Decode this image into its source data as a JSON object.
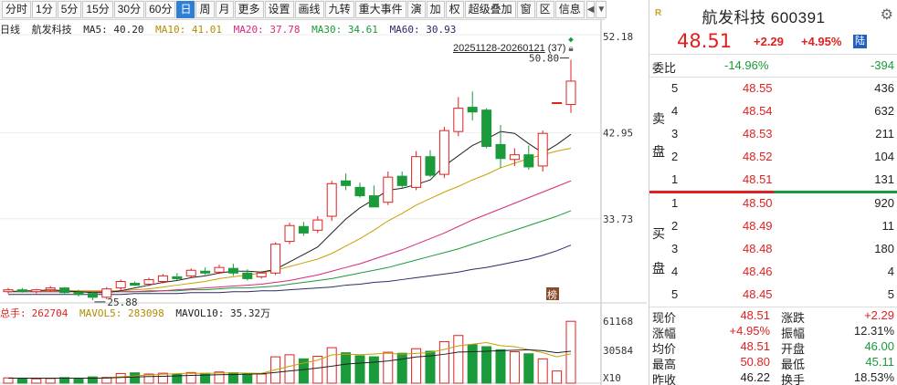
{
  "toolbar": {
    "buttons": [
      "分时",
      "1分",
      "5分",
      "15分",
      "30分",
      "60分",
      "日",
      "周",
      "月",
      "更多",
      "设置",
      "画线",
      "九转",
      "重大事件",
      "演",
      "加",
      "权",
      "超级叠加",
      "窗",
      "区",
      "信息"
    ],
    "active_index": 6
  },
  "ma_line": {
    "period": "日线",
    "name": "航发科技",
    "ma5": "MA5: 40.20",
    "ma10": "MA10: 41.01",
    "ma20": "MA20: 37.78",
    "ma30": "MA30: 34.61",
    "ma60": "MA60: 30.93",
    "colors": {
      "ma5": "#222222",
      "ma10": "#c8a000",
      "ma20": "#d6287c",
      "ma30": "#1a9a3a",
      "ma60": "#2a2a66"
    }
  },
  "range_label": {
    "text": "20251128-20260121",
    "count": "(37)"
  },
  "price_axis": {
    "top": "52.18",
    "mid": "42.95",
    "low": "33.73"
  },
  "annotations": {
    "high": "50.80",
    "low": "25.88",
    "badge": "榜"
  },
  "volume": {
    "label": "总手:",
    "total": "262704",
    "mavol5": "MAVOL5: 283098",
    "mavol10": "MAVOL10: 35.32万",
    "axis_top": "61168",
    "axis_mid": "30584",
    "axis_unit": "X10"
  },
  "chart_data": {
    "type": "candlestick",
    "price_range": [
      24.5,
      53.5
    ],
    "candles": [
      [
        25.9,
        26.3,
        25.7,
        26.1
      ],
      [
        26.1,
        26.3,
        25.8,
        25.9
      ],
      [
        25.9,
        26.2,
        25.7,
        26.1
      ],
      [
        26.1,
        26.5,
        25.9,
        26.3
      ],
      [
        26.3,
        26.4,
        25.7,
        25.8
      ],
      [
        25.8,
        26.1,
        25.4,
        25.6
      ],
      [
        25.7,
        25.9,
        25.0,
        25.3
      ],
      [
        25.3,
        26.4,
        25.1,
        26.2
      ],
      [
        26.3,
        27.2,
        26.0,
        27.0
      ],
      [
        26.8,
        27.0,
        26.5,
        26.6
      ],
      [
        26.7,
        27.4,
        26.5,
        27.2
      ],
      [
        27.0,
        27.8,
        26.8,
        27.6
      ],
      [
        27.5,
        27.9,
        27.1,
        27.3
      ],
      [
        27.6,
        28.4,
        27.4,
        28.2
      ],
      [
        28.1,
        28.5,
        27.7,
        27.9
      ],
      [
        28.0,
        28.8,
        27.8,
        28.5
      ],
      [
        28.4,
        28.9,
        27.6,
        27.9
      ],
      [
        27.9,
        28.3,
        27.1,
        27.3
      ],
      [
        27.5,
        28.1,
        27.3,
        27.9
      ],
      [
        27.9,
        31.2,
        27.7,
        31.0
      ],
      [
        31.3,
        33.3,
        31.0,
        33.0
      ],
      [
        32.9,
        33.4,
        31.9,
        32.2
      ],
      [
        32.5,
        34.0,
        32.2,
        33.6
      ],
      [
        34.0,
        37.8,
        33.5,
        37.5
      ],
      [
        37.8,
        38.6,
        36.8,
        37.3
      ],
      [
        37.1,
        37.6,
        36.0,
        36.2
      ],
      [
        36.2,
        37.3,
        35.0,
        35.0
      ],
      [
        35.5,
        38.8,
        35.2,
        38.2
      ],
      [
        38.3,
        38.8,
        37.0,
        37.3
      ],
      [
        37.1,
        41.0,
        36.8,
        40.4
      ],
      [
        40.4,
        41.1,
        38.2,
        38.4
      ],
      [
        38.5,
        43.6,
        38.1,
        43.2
      ],
      [
        43.1,
        46.8,
        42.6,
        45.6
      ],
      [
        45.7,
        47.4,
        44.3,
        45.2
      ],
      [
        45.4,
        45.6,
        41.3,
        41.5
      ],
      [
        41.7,
        43.8,
        39.2,
        40.2
      ],
      [
        40.1,
        41.3,
        39.4,
        40.6
      ],
      [
        40.6,
        41.6,
        39.0,
        39.3
      ],
      [
        39.4,
        43.2,
        38.8,
        42.9
      ],
      [
        46.2,
        46.2,
        46.2,
        46.2
      ],
      [
        46.0,
        50.8,
        45.1,
        48.51
      ]
    ],
    "volumes": [
      5200,
      4800,
      4300,
      4600,
      5500,
      4900,
      6200,
      5800,
      9500,
      10200,
      9000,
      9800,
      8900,
      10500,
      9700,
      11000,
      10300,
      9600,
      9000,
      26000,
      28000,
      24000,
      26500,
      35000,
      30000,
      27000,
      26000,
      30500,
      29500,
      34000,
      31500,
      41000,
      47000,
      38000,
      36000,
      33000,
      31000,
      29000,
      24000,
      12000,
      61000
    ],
    "ma5": [
      25.9,
      26.0,
      26.0,
      26.1,
      26.0,
      25.9,
      25.8,
      25.8,
      26.0,
      26.3,
      26.6,
      26.9,
      27.1,
      27.4,
      27.6,
      27.9,
      28.1,
      28.1,
      28.0,
      28.3,
      29.1,
      29.9,
      30.7,
      32.2,
      33.7,
      34.9,
      35.8,
      36.8,
      37.0,
      37.4,
      37.9,
      39.4,
      40.5,
      41.6,
      42.3,
      43.1,
      42.9,
      41.8,
      40.8,
      41.7,
      42.8
    ],
    "ma10": [
      25.9,
      25.9,
      26.0,
      26.0,
      26.0,
      26.0,
      26.0,
      26.0,
      26.0,
      26.1,
      26.2,
      26.4,
      26.6,
      26.8,
      27.0,
      27.3,
      27.5,
      27.7,
      27.9,
      28.2,
      28.6,
      29.0,
      29.4,
      30.0,
      30.8,
      31.6,
      32.5,
      33.5,
      34.3,
      35.2,
      35.9,
      36.6,
      37.2,
      37.9,
      38.5,
      39.2,
      39.7,
      40.2,
      40.6,
      41.0,
      41.3
    ],
    "ma20": [
      25.9,
      25.9,
      25.9,
      25.9,
      25.9,
      25.9,
      25.9,
      25.9,
      25.9,
      25.9,
      26.0,
      26.0,
      26.1,
      26.2,
      26.3,
      26.4,
      26.5,
      26.6,
      26.7,
      26.9,
      27.1,
      27.4,
      27.7,
      28.1,
      28.5,
      28.9,
      29.4,
      29.9,
      30.4,
      31.0,
      31.6,
      32.2,
      32.9,
      33.6,
      34.2,
      34.8,
      35.4,
      36.0,
      36.6,
      37.2,
      37.8
    ],
    "ma30": [
      25.9,
      25.9,
      25.9,
      25.9,
      25.9,
      25.9,
      25.9,
      25.9,
      25.9,
      25.9,
      25.9,
      26.0,
      26.0,
      26.1,
      26.1,
      26.2,
      26.3,
      26.3,
      26.4,
      26.5,
      26.7,
      26.9,
      27.1,
      27.3,
      27.6,
      27.9,
      28.2,
      28.5,
      28.9,
      29.3,
      29.7,
      30.1,
      30.5,
      31.0,
      31.5,
      32.0,
      32.5,
      33.0,
      33.5,
      34.0,
      34.6
    ],
    "ma60": [
      25.6,
      25.6,
      25.6,
      25.6,
      25.6,
      25.6,
      25.6,
      25.6,
      25.6,
      25.7,
      25.7,
      25.7,
      25.7,
      25.8,
      25.8,
      25.8,
      25.9,
      25.9,
      26.0,
      26.0,
      26.1,
      26.2,
      26.3,
      26.4,
      26.6,
      26.7,
      26.9,
      27.0,
      27.2,
      27.4,
      27.6,
      27.8,
      28.0,
      28.3,
      28.5,
      28.8,
      29.1,
      29.4,
      29.8,
      30.3,
      30.9
    ],
    "vol_ma5": [
      5000,
      5000,
      4900,
      4900,
      4900,
      4800,
      5100,
      5300,
      6400,
      7200,
      8100,
      8800,
      9500,
      9800,
      9600,
      10000,
      10100,
      9900,
      9700,
      13300,
      16600,
      19800,
      22700,
      27900,
      28700,
      28100,
      28800,
      29600,
      28600,
      29400,
      30300,
      33300,
      36800,
      38500,
      40000,
      37000,
      36000,
      33000,
      30000,
      26000,
      29000
    ],
    "vol_ma10": [
      5000,
      5000,
      5000,
      5000,
      5000,
      4950,
      5000,
      5100,
      5600,
      6100,
      6500,
      6800,
      7200,
      7600,
      8000,
      8300,
      8600,
      8900,
      9200,
      10600,
      12000,
      13400,
      15000,
      16800,
      18800,
      19800,
      20700,
      21900,
      23700,
      25900,
      26900,
      28500,
      30700,
      31000,
      31500,
      32000,
      32500,
      33000,
      32000,
      30000,
      31500
    ]
  },
  "quote": {
    "logo": "R",
    "name": "航发科技",
    "code": "600391",
    "price": "48.51",
    "change": "+2.29",
    "pct": "+4.95%",
    "flag": "陆",
    "webi_label": "委比",
    "webi_pct": "-14.96%",
    "webi_diff": "-394",
    "sell_side": "卖盘",
    "buy_side": "买盘",
    "sell": [
      {
        "lvl": "5",
        "px": "48.55",
        "qty": "436"
      },
      {
        "lvl": "4",
        "px": "48.54",
        "qty": "632"
      },
      {
        "lvl": "3",
        "px": "48.53",
        "qty": "211"
      },
      {
        "lvl": "2",
        "px": "48.52",
        "qty": "104"
      },
      {
        "lvl": "1",
        "px": "48.51",
        "qty": "131"
      }
    ],
    "buy": [
      {
        "lvl": "1",
        "px": "48.50",
        "qty": "920"
      },
      {
        "lvl": "2",
        "px": "48.49",
        "qty": "11"
      },
      {
        "lvl": "3",
        "px": "48.48",
        "qty": "180"
      },
      {
        "lvl": "4",
        "px": "48.46",
        "qty": "4"
      },
      {
        "lvl": "5",
        "px": "48.45",
        "qty": "5"
      }
    ],
    "stats": [
      {
        "l": "现价",
        "lv": "48.51",
        "lc": "red",
        "r": "涨跌",
        "rv": "+2.29",
        "rc": "red"
      },
      {
        "l": "涨幅",
        "lv": "+4.95%",
        "lc": "red",
        "r": "振幅",
        "rv": "12.31%",
        "rc": "dark"
      },
      {
        "l": "均价",
        "lv": "48.51",
        "lc": "red",
        "r": "开盘",
        "rv": "46.00",
        "rc": "green"
      },
      {
        "l": "最高",
        "lv": "50.80",
        "lc": "red",
        "r": "最低",
        "rv": "45.11",
        "rc": "green"
      },
      {
        "l": "昨收",
        "lv": "46.22",
        "lc": "dark",
        "r": "换手",
        "rv": "18.53%",
        "rc": "dark"
      }
    ]
  }
}
